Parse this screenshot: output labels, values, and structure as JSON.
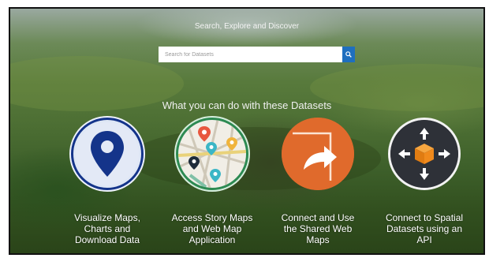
{
  "hero": {
    "heading": "Search, Explore and Discover",
    "search": {
      "placeholder": "Search for Datasets",
      "button_icon": "search-icon"
    },
    "subheading": "What you can do with these Datasets"
  },
  "colors": {
    "search_button": "#1f6fbf",
    "pin_blue": "#14348a",
    "map_green_ring": "#2d8a52",
    "connect_orange": "#e06a2c",
    "api_box_orange": "#f08a1c"
  },
  "features": [
    {
      "icon": "map-pin-icon",
      "lines": [
        "Visualize Maps,",
        "Charts and",
        "Download Data"
      ]
    },
    {
      "icon": "story-map-icon",
      "lines": [
        "Access Story Maps",
        "and Web Map",
        "Application"
      ]
    },
    {
      "icon": "share-arrow-icon",
      "lines": [
        "Connect and Use",
        "the Shared Web",
        "Maps"
      ]
    },
    {
      "icon": "api-cube-icon",
      "lines": [
        "Connect to Spatial",
        "Datasets using an",
        "API"
      ]
    }
  ]
}
